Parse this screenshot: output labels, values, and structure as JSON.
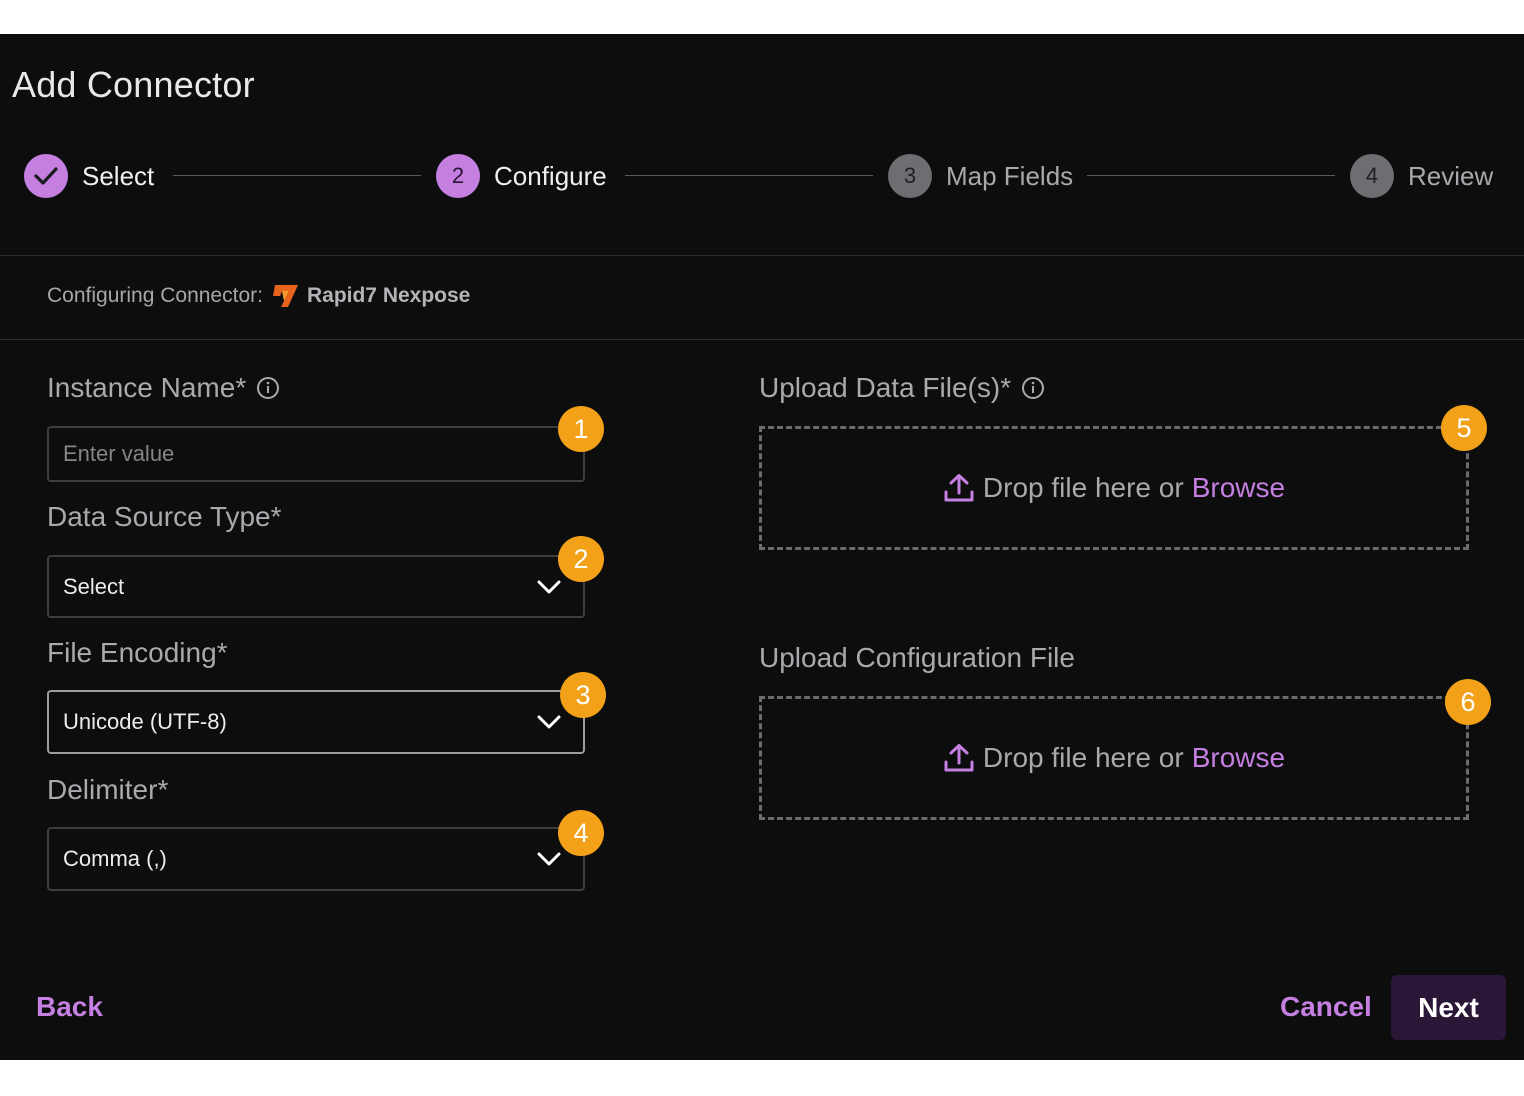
{
  "title": "Add Connector",
  "stepper": {
    "steps": [
      {
        "number": "",
        "label": "Select",
        "state": "completed"
      },
      {
        "number": "2",
        "label": "Configure",
        "state": "active"
      },
      {
        "number": "3",
        "label": "Map Fields",
        "state": "upcoming"
      },
      {
        "number": "4",
        "label": "Review",
        "state": "upcoming"
      }
    ]
  },
  "connector": {
    "prefix": "Configuring Connector:",
    "name": "Rapid7 Nexpose",
    "logo_icon": "rapid7-logo-icon"
  },
  "form": {
    "instance_name": {
      "label": "Instance Name*",
      "placeholder": "Enter value",
      "badge": "1"
    },
    "data_source_type": {
      "label": "Data Source Type*",
      "value": "Select",
      "badge": "2"
    },
    "file_encoding": {
      "label": "File Encoding*",
      "value": "Unicode (UTF-8)",
      "badge": "3"
    },
    "delimiter": {
      "label": "Delimiter*",
      "value": "Comma (,)",
      "badge": "4"
    },
    "upload_data": {
      "label": "Upload Data File(s)*",
      "drop_text": "Drop file here or",
      "browse": "Browse",
      "badge": "5"
    },
    "upload_config": {
      "label": "Upload Configuration File",
      "drop_text": "Drop file here or",
      "browse": "Browse",
      "badge": "6"
    }
  },
  "footer": {
    "back": "Back",
    "cancel": "Cancel",
    "next": "Next"
  },
  "colors": {
    "accent": "#c47fe0",
    "badge": "#f2a118",
    "background": "#0d0d0e",
    "next_button": "#2a1636"
  }
}
